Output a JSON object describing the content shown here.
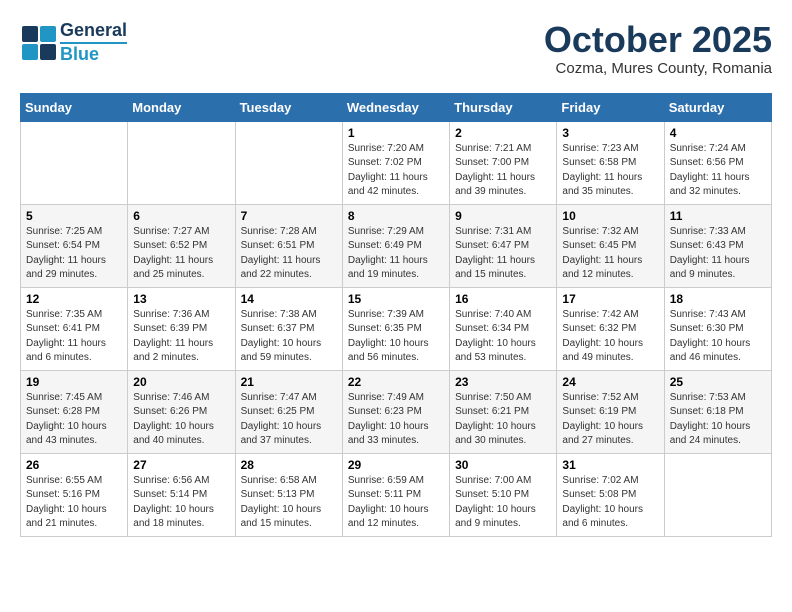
{
  "logo": {
    "line1": "General",
    "line2": "Blue"
  },
  "header": {
    "month": "October 2025",
    "location": "Cozma, Mures County, Romania"
  },
  "weekdays": [
    "Sunday",
    "Monday",
    "Tuesday",
    "Wednesday",
    "Thursday",
    "Friday",
    "Saturday"
  ],
  "weeks": [
    [
      {
        "day": "",
        "info": ""
      },
      {
        "day": "",
        "info": ""
      },
      {
        "day": "",
        "info": ""
      },
      {
        "day": "1",
        "info": "Sunrise: 7:20 AM\nSunset: 7:02 PM\nDaylight: 11 hours\nand 42 minutes."
      },
      {
        "day": "2",
        "info": "Sunrise: 7:21 AM\nSunset: 7:00 PM\nDaylight: 11 hours\nand 39 minutes."
      },
      {
        "day": "3",
        "info": "Sunrise: 7:23 AM\nSunset: 6:58 PM\nDaylight: 11 hours\nand 35 minutes."
      },
      {
        "day": "4",
        "info": "Sunrise: 7:24 AM\nSunset: 6:56 PM\nDaylight: 11 hours\nand 32 minutes."
      }
    ],
    [
      {
        "day": "5",
        "info": "Sunrise: 7:25 AM\nSunset: 6:54 PM\nDaylight: 11 hours\nand 29 minutes."
      },
      {
        "day": "6",
        "info": "Sunrise: 7:27 AM\nSunset: 6:52 PM\nDaylight: 11 hours\nand 25 minutes."
      },
      {
        "day": "7",
        "info": "Sunrise: 7:28 AM\nSunset: 6:51 PM\nDaylight: 11 hours\nand 22 minutes."
      },
      {
        "day": "8",
        "info": "Sunrise: 7:29 AM\nSunset: 6:49 PM\nDaylight: 11 hours\nand 19 minutes."
      },
      {
        "day": "9",
        "info": "Sunrise: 7:31 AM\nSunset: 6:47 PM\nDaylight: 11 hours\nand 15 minutes."
      },
      {
        "day": "10",
        "info": "Sunrise: 7:32 AM\nSunset: 6:45 PM\nDaylight: 11 hours\nand 12 minutes."
      },
      {
        "day": "11",
        "info": "Sunrise: 7:33 AM\nSunset: 6:43 PM\nDaylight: 11 hours\nand 9 minutes."
      }
    ],
    [
      {
        "day": "12",
        "info": "Sunrise: 7:35 AM\nSunset: 6:41 PM\nDaylight: 11 hours\nand 6 minutes."
      },
      {
        "day": "13",
        "info": "Sunrise: 7:36 AM\nSunset: 6:39 PM\nDaylight: 11 hours\nand 2 minutes."
      },
      {
        "day": "14",
        "info": "Sunrise: 7:38 AM\nSunset: 6:37 PM\nDaylight: 10 hours\nand 59 minutes."
      },
      {
        "day": "15",
        "info": "Sunrise: 7:39 AM\nSunset: 6:35 PM\nDaylight: 10 hours\nand 56 minutes."
      },
      {
        "day": "16",
        "info": "Sunrise: 7:40 AM\nSunset: 6:34 PM\nDaylight: 10 hours\nand 53 minutes."
      },
      {
        "day": "17",
        "info": "Sunrise: 7:42 AM\nSunset: 6:32 PM\nDaylight: 10 hours\nand 49 minutes."
      },
      {
        "day": "18",
        "info": "Sunrise: 7:43 AM\nSunset: 6:30 PM\nDaylight: 10 hours\nand 46 minutes."
      }
    ],
    [
      {
        "day": "19",
        "info": "Sunrise: 7:45 AM\nSunset: 6:28 PM\nDaylight: 10 hours\nand 43 minutes."
      },
      {
        "day": "20",
        "info": "Sunrise: 7:46 AM\nSunset: 6:26 PM\nDaylight: 10 hours\nand 40 minutes."
      },
      {
        "day": "21",
        "info": "Sunrise: 7:47 AM\nSunset: 6:25 PM\nDaylight: 10 hours\nand 37 minutes."
      },
      {
        "day": "22",
        "info": "Sunrise: 7:49 AM\nSunset: 6:23 PM\nDaylight: 10 hours\nand 33 minutes."
      },
      {
        "day": "23",
        "info": "Sunrise: 7:50 AM\nSunset: 6:21 PM\nDaylight: 10 hours\nand 30 minutes."
      },
      {
        "day": "24",
        "info": "Sunrise: 7:52 AM\nSunset: 6:19 PM\nDaylight: 10 hours\nand 27 minutes."
      },
      {
        "day": "25",
        "info": "Sunrise: 7:53 AM\nSunset: 6:18 PM\nDaylight: 10 hours\nand 24 minutes."
      }
    ],
    [
      {
        "day": "26",
        "info": "Sunrise: 6:55 AM\nSunset: 5:16 PM\nDaylight: 10 hours\nand 21 minutes."
      },
      {
        "day": "27",
        "info": "Sunrise: 6:56 AM\nSunset: 5:14 PM\nDaylight: 10 hours\nand 18 minutes."
      },
      {
        "day": "28",
        "info": "Sunrise: 6:58 AM\nSunset: 5:13 PM\nDaylight: 10 hours\nand 15 minutes."
      },
      {
        "day": "29",
        "info": "Sunrise: 6:59 AM\nSunset: 5:11 PM\nDaylight: 10 hours\nand 12 minutes."
      },
      {
        "day": "30",
        "info": "Sunrise: 7:00 AM\nSunset: 5:10 PM\nDaylight: 10 hours\nand 9 minutes."
      },
      {
        "day": "31",
        "info": "Sunrise: 7:02 AM\nSunset: 5:08 PM\nDaylight: 10 hours\nand 6 minutes."
      },
      {
        "day": "",
        "info": ""
      }
    ]
  ]
}
